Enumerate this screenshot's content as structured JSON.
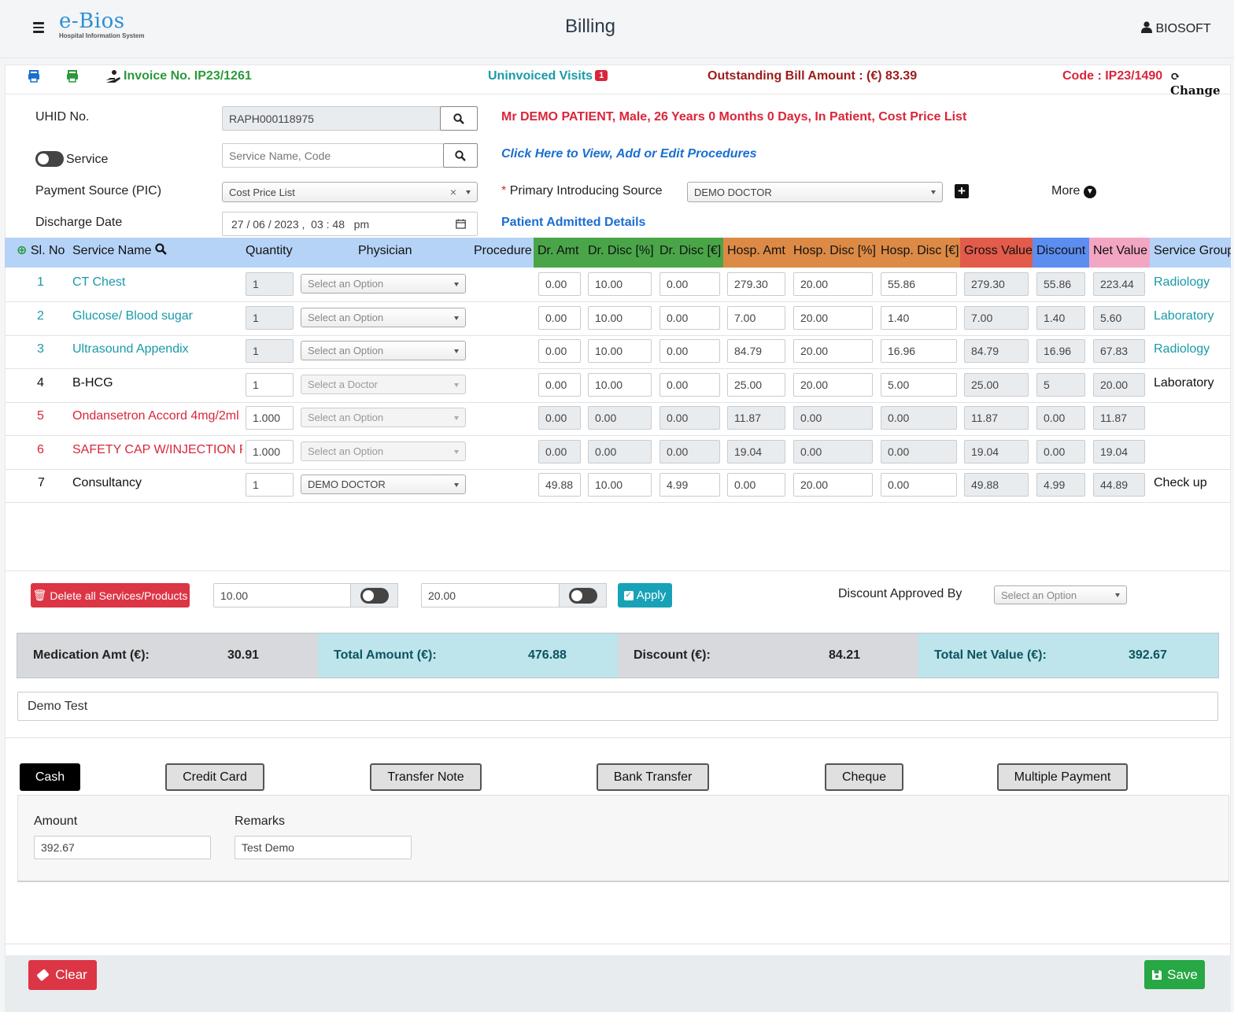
{
  "header": {
    "logo_main": "e-Bios",
    "logo_sub": "Hospital Information System",
    "title": "Billing",
    "user": "BIOSOFT"
  },
  "infobar": {
    "invoice": "Invoice No. IP23/1261",
    "uninvoiced_label": "Uninvoiced Visits",
    "uninvoiced_count": "1",
    "outstanding": "Outstanding Bill Amount : (€) 83.39",
    "code": "Code : IP23/1490",
    "change": "Change"
  },
  "form": {
    "uhid_label": "UHID No.",
    "uhid_value": "RAPH000118975",
    "patient_info": "Mr DEMO PATIENT, Male, 26 Years 0 Months 0 Days, In Patient, Cost Price List",
    "service_label": "Service",
    "service_placeholder": "Service Name, Code",
    "procedures_link": "Click Here to View, Add or Edit Procedures",
    "payment_source_label": "Payment Source (PIC)",
    "payment_source_value": "Cost Price List",
    "pis_required": "*",
    "pis_label": "Primary Introducing Source",
    "pis_value": "DEMO DOCTOR",
    "more": "More",
    "discharge_label": "Discharge Date",
    "discharge_value": "27 / 06 / 2023 ,  03 : 48   pm",
    "admitted_link": "Patient Admitted Details"
  },
  "table": {
    "headers": {
      "slno": "Sl. No",
      "service": "Service Name",
      "qty": "Quantity",
      "physician": "Physician",
      "procedure": "Procedure",
      "dr_amt": "Dr. Amt",
      "dr_disc_pct": "Dr. Disc [%]",
      "dr_disc_eur": "Dr. Disc [€]",
      "hosp_amt": "Hosp. Amt",
      "hosp_disc_pct": "Hosp. Disc [%]",
      "hosp_disc_eur": "Hosp. Disc [€]",
      "gross": "Gross Value",
      "discount": "Discount",
      "net": "Net Value",
      "group": "Service Group"
    },
    "rows": [
      {
        "slno": "1",
        "service": "CT Chest",
        "qty": "1",
        "physician": "Select an Option",
        "dr_amt": "0.00",
        "dr_disc_pct": "10.00",
        "dr_disc_eur": "0.00",
        "hosp_amt": "279.30",
        "hosp_disc_pct": "20.00",
        "hosp_disc_eur": "55.86",
        "gross": "279.30",
        "discount": "55.86",
        "net": "223.44",
        "group": "Radiology"
      },
      {
        "slno": "2",
        "service": "Glucose/ Blood sugar",
        "qty": "1",
        "physician": "Select an Option",
        "dr_amt": "0.00",
        "dr_disc_pct": "10.00",
        "dr_disc_eur": "0.00",
        "hosp_amt": "7.00",
        "hosp_disc_pct": "20.00",
        "hosp_disc_eur": "1.40",
        "gross": "7.00",
        "discount": "1.40",
        "net": "5.60",
        "group": "Laboratory"
      },
      {
        "slno": "3",
        "service": "Ultrasound Appendix",
        "qty": "1",
        "physician": "Select an Option",
        "dr_amt": "0.00",
        "dr_disc_pct": "10.00",
        "dr_disc_eur": "0.00",
        "hosp_amt": "84.79",
        "hosp_disc_pct": "20.00",
        "hosp_disc_eur": "16.96",
        "gross": "84.79",
        "discount": "16.96",
        "net": "67.83",
        "group": "Radiology"
      },
      {
        "slno": "4",
        "service": "B-HCG",
        "qty": "1",
        "physician": "Select a Doctor",
        "dr_amt": "0.00",
        "dr_disc_pct": "10.00",
        "dr_disc_eur": "0.00",
        "hosp_amt": "25.00",
        "hosp_disc_pct": "20.00",
        "hosp_disc_eur": "5.00",
        "gross": "25.00",
        "discount": "5",
        "net": "20.00",
        "group": "Laboratory"
      },
      {
        "slno": "5",
        "service": "Ondansetron Accord 4mg/2ml",
        "qty": "1.000",
        "physician": "Select an Option",
        "dr_amt": "0.00",
        "dr_disc_pct": "0.00",
        "dr_disc_eur": "0.00",
        "hosp_amt": "11.87",
        "hosp_disc_pct": "0.00",
        "hosp_disc_eur": "0.00",
        "gross": "11.87",
        "discount": "0.00",
        "net": "11.87",
        "group": ""
      },
      {
        "slno": "6",
        "service": "SAFETY CAP W/INJECTION PO",
        "qty": "1.000",
        "physician": "Select an Option",
        "dr_amt": "0.00",
        "dr_disc_pct": "0.00",
        "dr_disc_eur": "0.00",
        "hosp_amt": "19.04",
        "hosp_disc_pct": "0.00",
        "hosp_disc_eur": "0.00",
        "gross": "19.04",
        "discount": "0.00",
        "net": "19.04",
        "group": ""
      },
      {
        "slno": "7",
        "service": "Consultancy",
        "qty": "1",
        "physician": "DEMO DOCTOR",
        "dr_amt": "49.88",
        "dr_disc_pct": "10.00",
        "dr_disc_eur": "4.99",
        "hosp_amt": "0.00",
        "hosp_disc_pct": "20.00",
        "hosp_disc_eur": "0.00",
        "gross": "49.88",
        "discount": "4.99",
        "net": "44.89",
        "group": "Check up"
      }
    ]
  },
  "actions": {
    "delete_all": "Delete all Services/Products",
    "disc1": "10.00",
    "disc2": "20.00",
    "apply": "Apply",
    "approved_by_label": "Discount Approved By",
    "approved_by_value": "Select an Option"
  },
  "summary": {
    "medication_label": "Medication Amt (€):",
    "medication_value": "30.91",
    "total_label": "Total Amount (€):",
    "total_value": "476.88",
    "discount_label": "Discount (€):",
    "discount_value": "84.21",
    "net_label": "Total Net Value (€):",
    "net_value": "392.67"
  },
  "note": "Demo Test",
  "payment": {
    "tabs": [
      "Cash",
      "Credit Card",
      "Transfer Note",
      "Bank Transfer",
      "Cheque",
      "Multiple Payment"
    ],
    "amount_label": "Amount",
    "amount_value": "392.67",
    "remarks_label": "Remarks",
    "remarks_value": "Test Demo"
  },
  "footer": {
    "clear": "Clear",
    "save": "Save"
  },
  "colors": {
    "dr_header": "#4aa548",
    "hosp_header": "#dc8a45",
    "gross_header": "#e25b4b",
    "discount_header": "#5b8ef0",
    "net_header": "#f3a6c3",
    "teal": "#1a9aa8",
    "red": "#d9263b"
  }
}
